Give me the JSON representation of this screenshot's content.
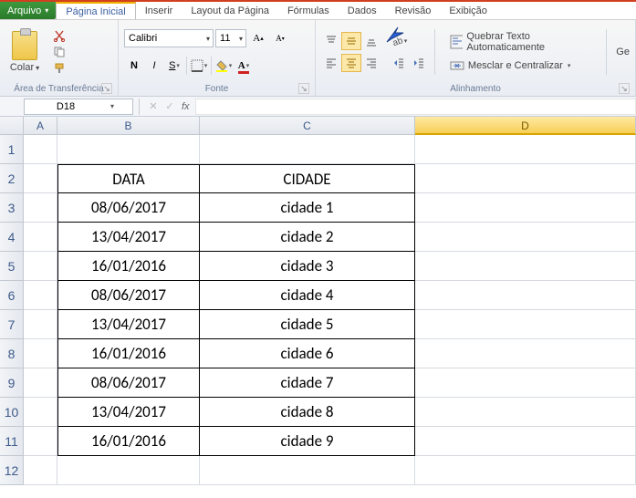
{
  "menu": {
    "file": "Arquivo",
    "tabs": [
      "Página Inicial",
      "Inserir",
      "Layout da Página",
      "Fórmulas",
      "Dados",
      "Revisão",
      "Exibição"
    ],
    "active": 0
  },
  "ribbon": {
    "clipboard": {
      "paste": "Colar",
      "label": "Área de Transferência"
    },
    "font": {
      "name": "Calibri",
      "size": "11",
      "label": "Fonte"
    },
    "alignment": {
      "wrap": "Quebrar Texto Automaticamente",
      "merge": "Mesclar e Centralizar",
      "label": "Alinhamento"
    },
    "general_partial": "Ge"
  },
  "namebox": "D18",
  "formula": "",
  "columns": [
    "A",
    "B",
    "C",
    "D"
  ],
  "selected_col": "D",
  "rows": [
    "1",
    "2",
    "3",
    "4",
    "5",
    "6",
    "7",
    "8",
    "9",
    "10",
    "11",
    "12"
  ],
  "table": {
    "headers": [
      "DATA",
      "CIDADE"
    ],
    "rows": [
      [
        "08/06/2017",
        "cidade 1"
      ],
      [
        "13/04/2017",
        "cidade 2"
      ],
      [
        "16/01/2016",
        "cidade 3"
      ],
      [
        "08/06/2017",
        "cidade 4"
      ],
      [
        "13/04/2017",
        "cidade 5"
      ],
      [
        "16/01/2016",
        "cidade 6"
      ],
      [
        "08/06/2017",
        "cidade 7"
      ],
      [
        "13/04/2017",
        "cidade 8"
      ],
      [
        "16/01/2016",
        "cidade 9"
      ]
    ]
  }
}
